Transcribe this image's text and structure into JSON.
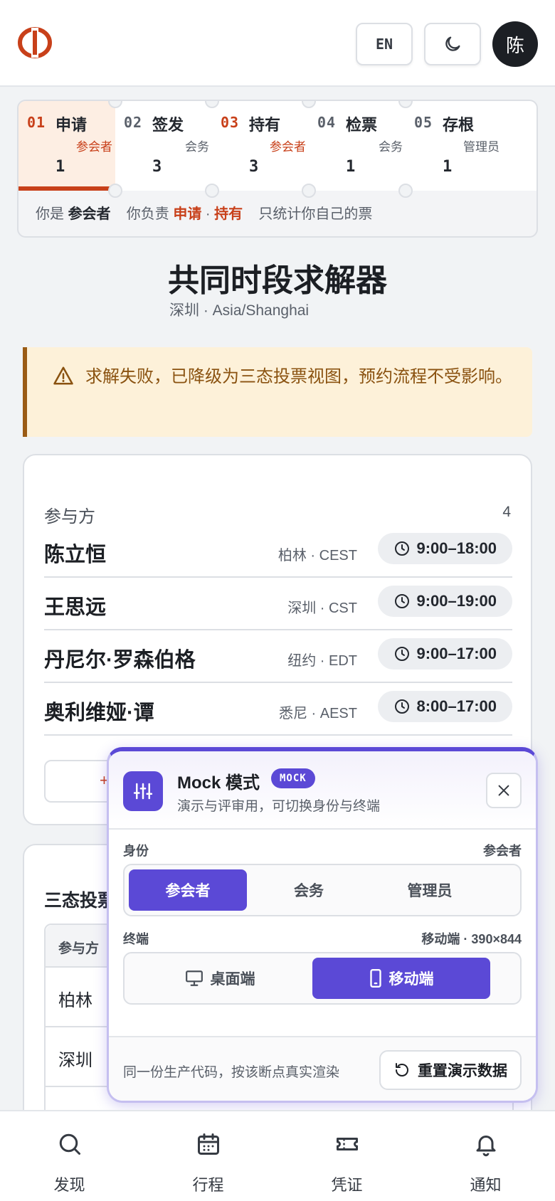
{
  "header": {
    "lang_label": "EN",
    "avatar_initial": "陈"
  },
  "steps": [
    {
      "num": "01",
      "name": "申请",
      "role": "参会者",
      "count": "1",
      "active": true
    },
    {
      "num": "02",
      "name": "签发",
      "role": "会务",
      "count": "3",
      "active": false
    },
    {
      "num": "03",
      "name": "持有",
      "role": "参会者",
      "count": "3",
      "active": false
    },
    {
      "num": "04",
      "name": "检票",
      "role": "会务",
      "count": "1",
      "active": false
    },
    {
      "num": "05",
      "name": "存根",
      "role": "管理员",
      "count": "1",
      "active": false
    }
  ],
  "summary": {
    "you_are_prefix": "你是",
    "you_are_role": "参会者",
    "responsible_prefix": "你负责",
    "responsible_a": "申请",
    "dot": "·",
    "responsible_b": "持有",
    "scope_note": "只统计你自己的票"
  },
  "page": {
    "title": "共同时段求解器",
    "subtitle": "深圳 · Asia/Shanghai"
  },
  "alert": {
    "text": "求解失败，已降级为三态投票视图，预约流程不受影响。"
  },
  "participants": {
    "label": "参与方",
    "count": "4",
    "rows": [
      {
        "name": "陈立恒",
        "zone": "柏林 · CEST",
        "hours": "9:00–18:00"
      },
      {
        "name": "王思远",
        "zone": "深圳 · CST",
        "hours": "9:00–19:00"
      },
      {
        "name": "丹尼尔·罗森伯格",
        "zone": "纽约 · EDT",
        "hours": "9:00–17:00"
      },
      {
        "name": "奥利维娅·谭",
        "zone": "悉尼 · AEST",
        "hours": "8:00–17:00"
      }
    ]
  },
  "vote": {
    "title": "三态投票",
    "col_header": "参与方",
    "rows": [
      "柏林",
      "深圳"
    ]
  },
  "mock": {
    "title": "Mock 模式",
    "badge": "MOCK",
    "subtitle": "演示与评审用，可切换身份与终端",
    "identity_label": "身份",
    "identity_value": "参会者",
    "identities": [
      "参会者",
      "会务",
      "管理员"
    ],
    "identity_selected": 0,
    "device_label": "终端",
    "device_value": "移动端 · 390×844",
    "devices": [
      "桌面端",
      "移动端"
    ],
    "device_selected": 1,
    "footer_note": "同一份生产代码，按该断点真实渲染",
    "reset_label": "重置演示数据",
    "accent": "#5b49d6"
  },
  "nav": [
    {
      "label": "发现",
      "icon": "search-icon"
    },
    {
      "label": "行程",
      "icon": "calendar-icon"
    },
    {
      "label": "凭证",
      "icon": "ticket-icon"
    },
    {
      "label": "通知",
      "icon": "bell-icon"
    }
  ],
  "colors": {
    "brand": "#c8401a",
    "warning_text": "#8a5210",
    "warning_bg": "#fdf1d9"
  }
}
